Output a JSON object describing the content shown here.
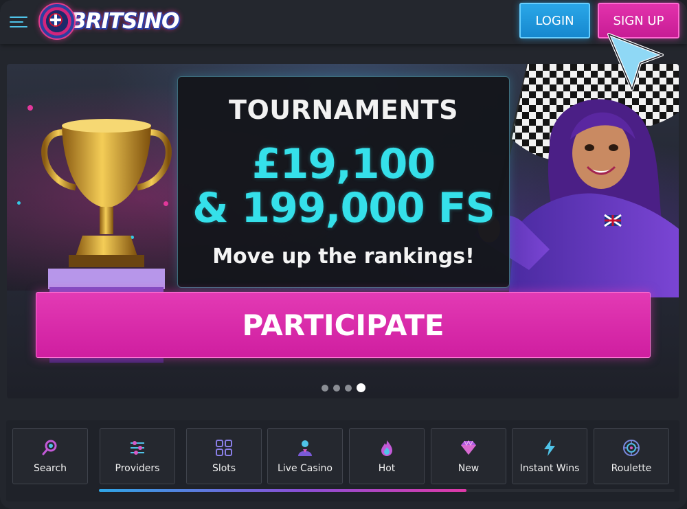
{
  "header": {
    "brand": "BRITSINO",
    "login_label": "LOGIN",
    "signup_label": "SIGN UP"
  },
  "banner": {
    "title": "TOURNAMENTS",
    "amount": "£19,100",
    "free_spins": "& 199,000 FS",
    "subtitle": "Move up the rankings!",
    "cta_label": "PARTICIPATE",
    "trophy_number": "1",
    "slides_total": 4,
    "active_slide": 4
  },
  "categories": [
    {
      "label": "Search",
      "icon": "search-icon"
    },
    {
      "label": "Providers",
      "icon": "providers-icon"
    },
    {
      "label": "Slots",
      "icon": "slots-icon"
    },
    {
      "label": "Live Casino",
      "icon": "live-dealer-icon"
    },
    {
      "label": "Hot",
      "icon": "fire-icon"
    },
    {
      "label": "New",
      "icon": "diamond-icon"
    },
    {
      "label": "Instant Wins",
      "icon": "lightning-icon"
    },
    {
      "label": "Roulette",
      "icon": "roulette-icon"
    }
  ],
  "colors": {
    "accent_cyan": "#35e0ea",
    "login_blue": "#1e9ae0",
    "signup_pink": "#d327a0",
    "background": "#23262d"
  }
}
